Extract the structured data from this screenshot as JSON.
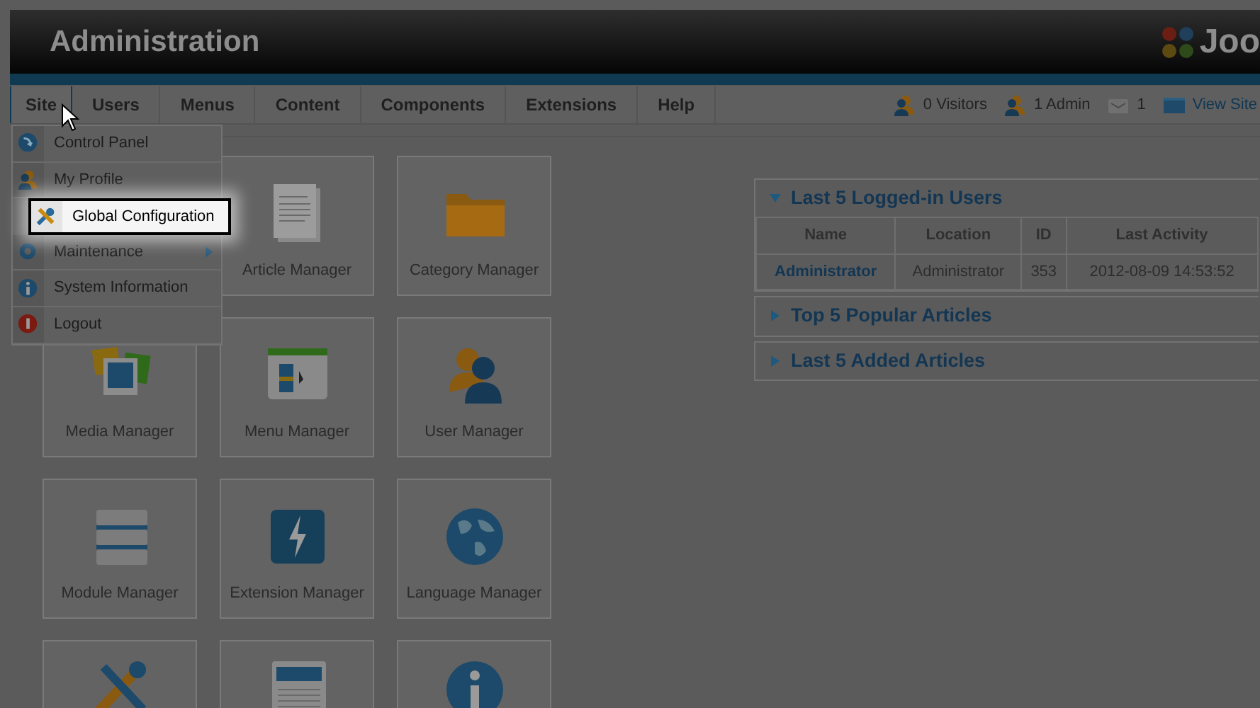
{
  "header": {
    "title": "Administration",
    "logo_text": "Joo"
  },
  "menubar": {
    "tabs": [
      {
        "label": "Site",
        "selected": true
      },
      {
        "label": "Users",
        "selected": false
      },
      {
        "label": "Menus",
        "selected": false
      },
      {
        "label": "Content",
        "selected": false
      },
      {
        "label": "Components",
        "selected": false
      },
      {
        "label": "Extensions",
        "selected": false
      },
      {
        "label": "Help",
        "selected": false
      }
    ],
    "status": [
      {
        "kind": "visitors",
        "text": "0 Visitors"
      },
      {
        "kind": "admins",
        "text": "1 Admin"
      },
      {
        "kind": "messages",
        "text": "1"
      },
      {
        "kind": "site",
        "text": "View Site"
      }
    ]
  },
  "site_menu": {
    "items": [
      {
        "label": "Control Panel",
        "kind": "dashboard",
        "highlighted": false,
        "has_submenu": false
      },
      {
        "label": "My Profile",
        "kind": "profile",
        "highlighted": false,
        "has_submenu": false
      },
      {
        "label": "Global Configuration",
        "kind": "config",
        "highlighted": true,
        "has_submenu": false
      },
      {
        "label": "Maintenance",
        "kind": "maintenance",
        "highlighted": false,
        "has_submenu": true
      },
      {
        "label": "System Information",
        "kind": "info",
        "highlighted": false,
        "has_submenu": false
      },
      {
        "label": "Logout",
        "kind": "logout",
        "highlighted": false,
        "has_submenu": false
      }
    ]
  },
  "quick_icons": [
    {
      "label": "Article Manager",
      "kind": "article"
    },
    {
      "label": "Category Manager",
      "kind": "folder"
    },
    {
      "label": "Media Manager",
      "kind": "media"
    },
    {
      "label": "Menu Manager",
      "kind": "menu"
    },
    {
      "label": "User Manager",
      "kind": "users"
    },
    {
      "label": "Module Manager",
      "kind": "module"
    },
    {
      "label": "Extension Manager",
      "kind": "extension"
    },
    {
      "label": "Language Manager",
      "kind": "globe"
    },
    {
      "kind": "tools"
    },
    {
      "kind": "document"
    },
    {
      "kind": "info"
    }
  ],
  "panels": [
    {
      "title": "Last 5 Logged-in Users",
      "expanded": true,
      "table": {
        "columns": [
          "Name",
          "Location",
          "ID",
          "Last Activity"
        ],
        "rows": [
          [
            "Administrator",
            "Administrator",
            "353",
            "2012-08-09 14:53:52"
          ]
        ]
      }
    },
    {
      "title": "Top 5 Popular Articles",
      "expanded": false
    },
    {
      "title": "Last 5 Added Articles",
      "expanded": false
    }
  ]
}
